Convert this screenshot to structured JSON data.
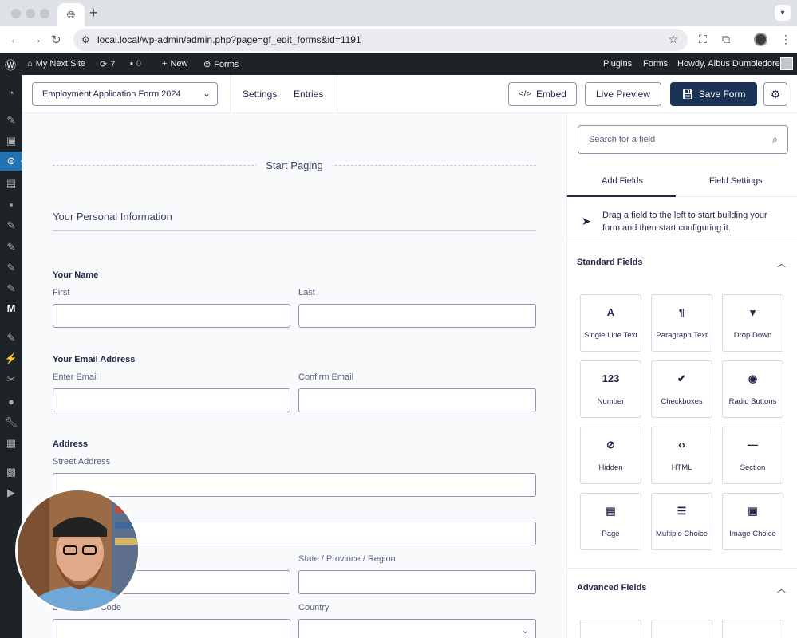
{
  "browser": {
    "url": "local.local/wp-admin/admin.php?page=gf_edit_forms&id=1191",
    "new_tab": "+"
  },
  "adminbar": {
    "site_name": "My Next Site",
    "updates_count": "7",
    "comments_count": "0",
    "new_label": "New",
    "forms_label": "Forms",
    "right_plugins": "Plugins",
    "right_forms": "Forms",
    "howdy": "Howdy, Albus Dumbledore"
  },
  "toolbar": {
    "form_name": "Employment Application Form 2024",
    "settings": "Settings",
    "entries": "Entries",
    "embed": "Embed",
    "live_preview": "Live Preview",
    "save_form": "Save Form"
  },
  "canvas": {
    "paging_label": "Start Paging",
    "section_title": "Your Personal Information",
    "name": {
      "label": "Your Name",
      "first": "First",
      "last": "Last"
    },
    "email": {
      "label": "Your Email Address",
      "enter": "Enter Email",
      "confirm": "Confirm Email"
    },
    "address": {
      "label": "Address",
      "street": "Street Address",
      "state": "State / Province / Region",
      "postal": "ZIP / Postal Code",
      "country": "Country"
    }
  },
  "panel": {
    "search_placeholder": "Search for a field",
    "tab_add": "Add Fields",
    "tab_settings": "Field Settings",
    "hint": "Drag a field to the left to start building your form and then start configuring it.",
    "standard_title": "Standard Fields",
    "advanced_title": "Advanced Fields",
    "tiles": [
      {
        "label": "Single Line Text",
        "icon": "A"
      },
      {
        "label": "Paragraph Text",
        "icon": "¶"
      },
      {
        "label": "Drop Down",
        "icon": "▾"
      },
      {
        "label": "Number",
        "icon": "123"
      },
      {
        "label": "Checkboxes",
        "icon": "✔"
      },
      {
        "label": "Radio Buttons",
        "icon": "◉"
      },
      {
        "label": "Hidden",
        "icon": "⊘"
      },
      {
        "label": "HTML",
        "icon": "‹›"
      },
      {
        "label": "Section",
        "icon": "—"
      },
      {
        "label": "Page",
        "icon": "▤"
      },
      {
        "label": "Multiple Choice",
        "icon": "☰"
      },
      {
        "label": "Image Choice",
        "icon": "▣"
      }
    ]
  }
}
